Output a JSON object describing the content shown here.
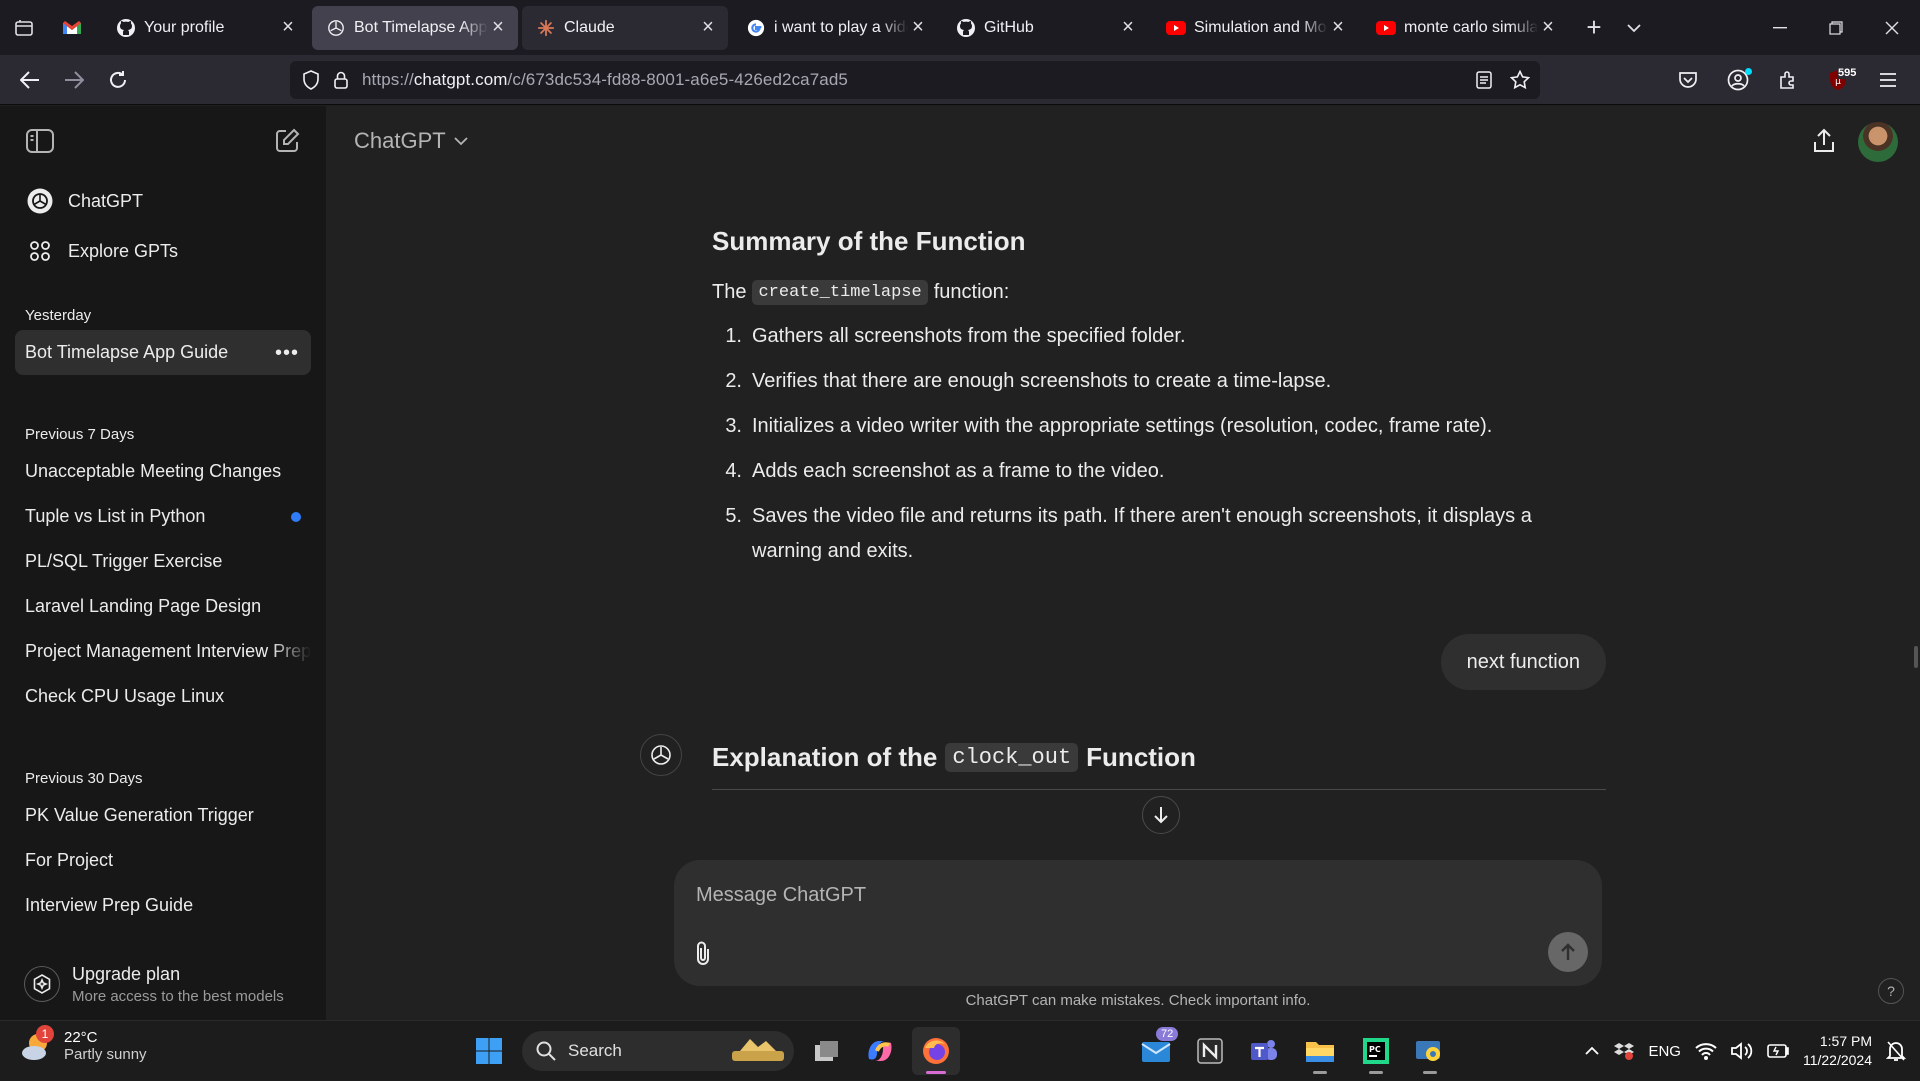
{
  "browser": {
    "tabs": [
      {
        "label": "",
        "favicon": "gmail-icon"
      },
      {
        "label": "Your profile",
        "favicon": "github-icon"
      },
      {
        "label": "Bot Timelapse App Guide",
        "favicon": "openai-icon",
        "active": true
      },
      {
        "label": "Claude",
        "favicon": "claude-icon"
      },
      {
        "label": "i want to play a video",
        "favicon": "google-icon"
      },
      {
        "label": "GitHub",
        "favicon": "github-icon"
      },
      {
        "label": "Simulation and Modeling",
        "favicon": "youtube-icon"
      },
      {
        "label": "monte carlo simulation",
        "favicon": "youtube-icon"
      }
    ],
    "url_prefix": "https://",
    "url_host": "chatgpt.com",
    "url_path": "/c/673dc534-fd88-8001-a6e5-426ed2ca7ad5",
    "extension_badge": "595"
  },
  "sidebar": {
    "links": [
      {
        "label": "ChatGPT",
        "icon": "openai-icon"
      },
      {
        "label": "Explore GPTs",
        "icon": "grid-icon"
      }
    ],
    "sections": [
      {
        "title": "Yesterday",
        "items": [
          "Bot Timelapse App Guide"
        ]
      },
      {
        "title": "Previous 7 Days",
        "items": [
          "Unacceptable Meeting Changes",
          "Tuple vs List in Python",
          "PL/SQL Trigger Exercise",
          "Laravel Landing Page Design",
          "Project Management Interview Prep",
          "Check CPU Usage Linux"
        ]
      },
      {
        "title": "Previous 30 Days",
        "items": [
          "PK Value Generation Trigger",
          "For Project",
          "Interview Prep Guide"
        ]
      }
    ],
    "upgrade": {
      "title": "Upgrade plan",
      "subtitle": "More access to the best models"
    }
  },
  "header": {
    "model": "ChatGPT"
  },
  "conversation": {
    "summary_heading": "Summary of the Function",
    "intro_before": "The",
    "intro_code": "create_timelapse",
    "intro_after": "function:",
    "steps": [
      {
        "n": "1.",
        "text": "Gathers all screenshots from the specified folder."
      },
      {
        "n": "2.",
        "text": "Verifies that there are enough screenshots to create a time-lapse."
      },
      {
        "n": "3.",
        "text": "Initializes a video writer with the appropriate settings (resolution, codec, frame rate)."
      },
      {
        "n": "4.",
        "text": "Adds each screenshot as a frame to the video."
      },
      {
        "n": "5.",
        "text": "Saves the video file and returns its path. If there aren't enough screenshots, it displays a warning and exits."
      }
    ],
    "user_message": "next function",
    "explain_before": "Explanation of the",
    "explain_code": "clock_out",
    "explain_after": "Function"
  },
  "composer": {
    "placeholder": "Message ChatGPT",
    "disclaimer": "ChatGPT can make mistakes. Check important info.",
    "help": "?"
  },
  "taskbar": {
    "weather_temp": "22°C",
    "weather_desc": "Partly sunny",
    "weather_badge": "1",
    "search_label": "Search",
    "mail_badge": "72",
    "language": "ENG",
    "time": "1:57 PM",
    "date": "11/22/2024"
  }
}
